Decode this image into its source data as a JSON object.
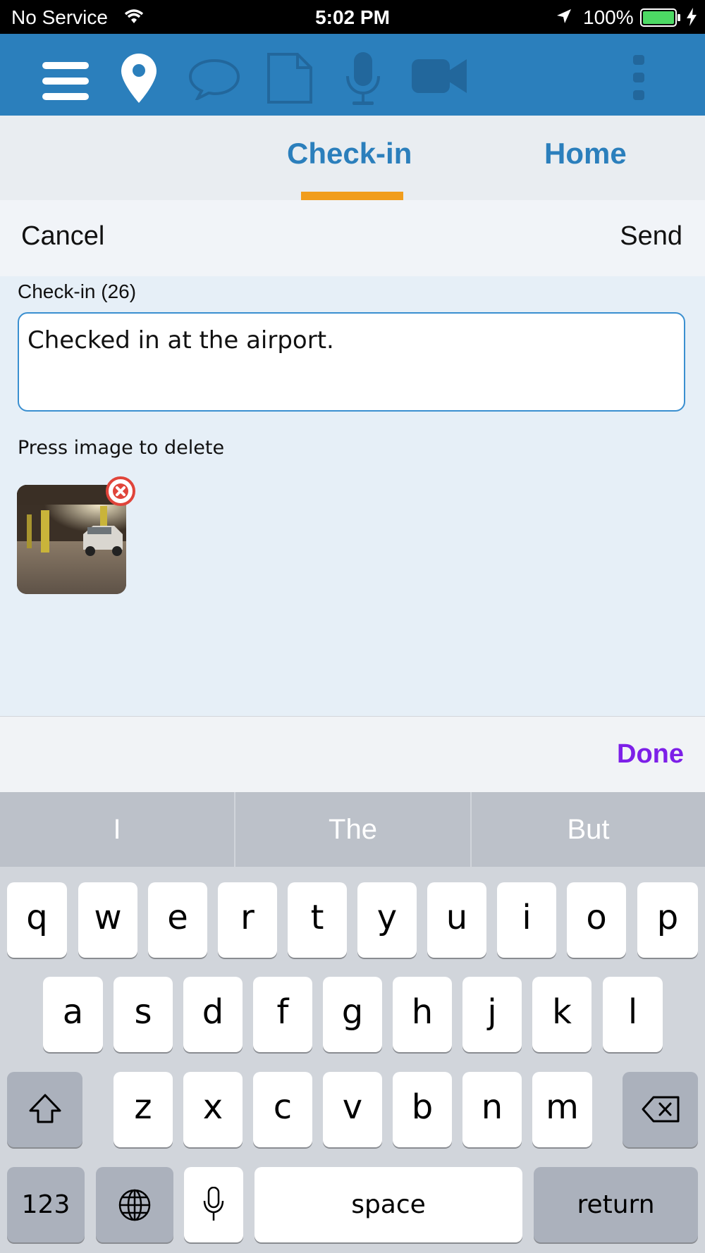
{
  "status_bar": {
    "carrier": "No Service",
    "time": "5:02 PM",
    "battery": "100%",
    "battery_color": "#4cd964"
  },
  "toolbar": {
    "icons": [
      "menu-icon",
      "location-pin-icon",
      "chat-bubble-icon",
      "document-icon",
      "microphone-icon",
      "video-camera-icon",
      "more-vertical-icon"
    ],
    "active_color": "#ffffff",
    "inactive_color": "#22679c"
  },
  "tabs": [
    {
      "label": "Check-in",
      "active": true
    },
    {
      "label": "Home",
      "active": false
    }
  ],
  "action_bar": {
    "cancel_label": "Cancel",
    "send_label": "Send"
  },
  "form": {
    "field_label": "Check-in (26)",
    "text_value": "Checked in at the airport.",
    "hint": "Press image to delete"
  },
  "done_label": "Done",
  "keyboard": {
    "suggestions": [
      "I",
      "The",
      "But"
    ],
    "row1": [
      "q",
      "w",
      "e",
      "r",
      "t",
      "y",
      "u",
      "i",
      "o",
      "p"
    ],
    "row2": [
      "a",
      "s",
      "d",
      "f",
      "g",
      "h",
      "j",
      "k",
      "l"
    ],
    "row3": [
      "z",
      "x",
      "c",
      "v",
      "b",
      "n",
      "m"
    ],
    "numbers_label": "123",
    "space_label": "space",
    "return_label": "return"
  },
  "colors": {
    "accent": "#2b7fbc",
    "tab_indicator": "#f19d1d",
    "done": "#7d1fe8"
  }
}
